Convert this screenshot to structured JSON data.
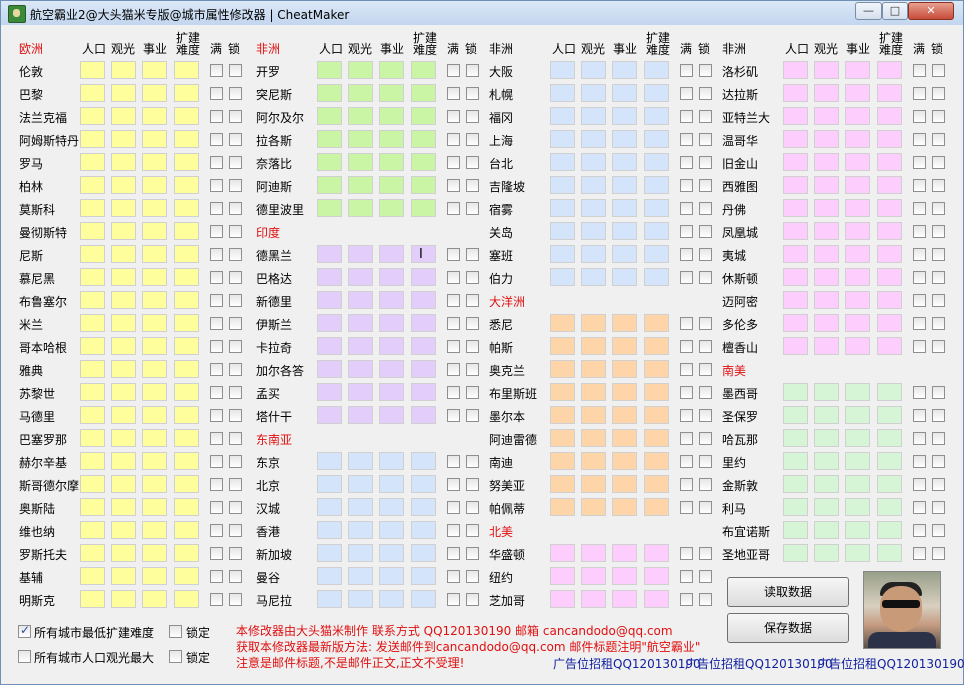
{
  "window": {
    "title": "航空霸业2@大头猫米专版@城市属性修改器 | CheatMaker",
    "min_label": "—",
    "max_label": "□",
    "close_label": "✕"
  },
  "headers": {
    "population": "人口",
    "sightseeing": "观光",
    "business": "事业",
    "expand_difficulty_top": "扩建",
    "expand_difficulty_bottom": "难度",
    "full": "满",
    "lock": "锁"
  },
  "colors": {
    "yellow": "#fefe9c",
    "green": "#c9f5a4",
    "purple": "#e3cdfa",
    "blue": "#d4e4fa",
    "orange": "#fed5a8",
    "pink": "#fdcdfd",
    "mint": "#d6f5d6",
    "region_red": "#e01010"
  },
  "columns": [
    {
      "rows": [
        {
          "label": "欧洲",
          "type": "region"
        },
        {
          "label": "伦敦",
          "color": "yellow"
        },
        {
          "label": "巴黎",
          "color": "yellow"
        },
        {
          "label": "法兰克福",
          "color": "yellow"
        },
        {
          "label": "阿姆斯特丹",
          "color": "yellow"
        },
        {
          "label": "罗马",
          "color": "yellow"
        },
        {
          "label": "柏林",
          "color": "yellow"
        },
        {
          "label": "莫斯科",
          "color": "yellow"
        },
        {
          "label": "曼彻斯特",
          "color": "yellow"
        },
        {
          "label": "尼斯",
          "color": "yellow"
        },
        {
          "label": "慕尼黑",
          "color": "yellow"
        },
        {
          "label": "布鲁塞尔",
          "color": "yellow"
        },
        {
          "label": "米兰",
          "color": "yellow"
        },
        {
          "label": "哥本哈根",
          "color": "yellow"
        },
        {
          "label": "雅典",
          "color": "yellow"
        },
        {
          "label": "苏黎世",
          "color": "yellow"
        },
        {
          "label": "马德里",
          "color": "yellow"
        },
        {
          "label": "巴塞罗那",
          "color": "yellow"
        },
        {
          "label": "赫尔辛基",
          "color": "yellow"
        },
        {
          "label": "斯哥德尔摩",
          "color": "yellow"
        },
        {
          "label": "奥斯陆",
          "color": "yellow"
        },
        {
          "label": "维也纳",
          "color": "yellow"
        },
        {
          "label": "罗斯托夫",
          "color": "yellow"
        },
        {
          "label": "基辅",
          "color": "yellow"
        },
        {
          "label": "明斯克",
          "color": "yellow"
        }
      ]
    },
    {
      "rows": [
        {
          "label": "非洲",
          "type": "region"
        },
        {
          "label": "开罗",
          "color": "green"
        },
        {
          "label": "突尼斯",
          "color": "green"
        },
        {
          "label": "阿尔及尔",
          "color": "green"
        },
        {
          "label": "拉各斯",
          "color": "green"
        },
        {
          "label": "奈落比",
          "color": "green"
        },
        {
          "label": "阿迪斯",
          "color": "green"
        },
        {
          "label": "德里波里",
          "color": "green"
        },
        {
          "label": "印度",
          "type": "region"
        },
        {
          "label": "德黑兰",
          "color": "purple"
        },
        {
          "label": "巴格达",
          "color": "purple"
        },
        {
          "label": "新德里",
          "color": "purple"
        },
        {
          "label": "伊斯兰",
          "color": "purple"
        },
        {
          "label": "卡拉奇",
          "color": "purple"
        },
        {
          "label": "加尔各答",
          "color": "purple"
        },
        {
          "label": "孟买",
          "color": "purple"
        },
        {
          "label": "塔什干",
          "color": "purple"
        },
        {
          "label": "东南亚",
          "type": "region"
        },
        {
          "label": "东京",
          "color": "blue"
        },
        {
          "label": "北京",
          "color": "blue"
        },
        {
          "label": "汉城",
          "color": "blue"
        },
        {
          "label": "香港",
          "color": "blue"
        },
        {
          "label": "新加坡",
          "color": "blue"
        },
        {
          "label": "曼谷",
          "color": "blue"
        },
        {
          "label": "马尼拉",
          "color": "blue"
        }
      ]
    },
    {
      "rows": [
        {
          "label": "非洲",
          "type": "region-black"
        },
        {
          "label": "大阪",
          "color": "blue"
        },
        {
          "label": "札幌",
          "color": "blue"
        },
        {
          "label": "福冈",
          "color": "blue"
        },
        {
          "label": "上海",
          "color": "blue"
        },
        {
          "label": "台北",
          "color": "blue"
        },
        {
          "label": "吉隆坡",
          "color": "blue"
        },
        {
          "label": "宿雾",
          "color": "blue"
        },
        {
          "label": "关岛",
          "color": "blue"
        },
        {
          "label": "塞班",
          "color": "blue"
        },
        {
          "label": "伯力",
          "color": "blue"
        },
        {
          "label": "大洋洲",
          "type": "region"
        },
        {
          "label": "悉尼",
          "color": "orange"
        },
        {
          "label": "帕斯",
          "color": "orange"
        },
        {
          "label": "奥克兰",
          "color": "orange"
        },
        {
          "label": "布里斯班",
          "color": "orange"
        },
        {
          "label": "墨尔本",
          "color": "orange"
        },
        {
          "label": "阿迪雷德",
          "color": "orange"
        },
        {
          "label": "南迪",
          "color": "orange"
        },
        {
          "label": "努美亚",
          "color": "orange"
        },
        {
          "label": "帕佩蒂",
          "color": "orange"
        },
        {
          "label": "北美",
          "type": "region"
        },
        {
          "label": "华盛顿",
          "color": "pink"
        },
        {
          "label": "纽约",
          "color": "pink"
        },
        {
          "label": "芝加哥",
          "color": "pink"
        }
      ]
    },
    {
      "rows": [
        {
          "label": "非洲",
          "type": "region-black"
        },
        {
          "label": "洛杉矶",
          "color": "pink"
        },
        {
          "label": "达拉斯",
          "color": "pink"
        },
        {
          "label": "亚特兰大",
          "color": "pink"
        },
        {
          "label": "温哥华",
          "color": "pink"
        },
        {
          "label": "旧金山",
          "color": "pink"
        },
        {
          "label": "西雅图",
          "color": "pink"
        },
        {
          "label": "丹佛",
          "color": "pink"
        },
        {
          "label": "凤凰城",
          "color": "pink"
        },
        {
          "label": "夷城",
          "color": "pink"
        },
        {
          "label": "休斯顿",
          "color": "pink"
        },
        {
          "label": "迈阿密",
          "color": "pink"
        },
        {
          "label": "多伦多",
          "color": "pink"
        },
        {
          "label": "檀香山",
          "color": "pink"
        },
        {
          "label": "南美",
          "type": "region"
        },
        {
          "label": "墨西哥",
          "color": "mint"
        },
        {
          "label": "圣保罗",
          "color": "mint"
        },
        {
          "label": "哈瓦那",
          "color": "mint"
        },
        {
          "label": "里约",
          "color": "mint"
        },
        {
          "label": "金斯敦",
          "color": "mint"
        },
        {
          "label": "利马",
          "color": "mint"
        },
        {
          "label": "布宜诺斯",
          "color": "mint"
        },
        {
          "label": "圣地亚哥",
          "color": "mint"
        }
      ]
    }
  ],
  "bottom": {
    "min_expand_label": "所有城市最低扩建难度",
    "min_expand_checked": true,
    "max_pop_label": "所有城市人口观光最大",
    "max_pop_checked": false,
    "lock_label_1": "锁定",
    "lock_label_2": "锁定",
    "note_line1": "本修改器由大头猫米制作  联系方式  QQ120130190 邮箱 cancandodo@qq.com",
    "note_line2": "获取本修改器最新版方法:  发送邮件到cancandodo@qq.com  邮件标题注明\"航空霸业\"",
    "note_line3": "注意是邮件标题,不是邮件正文,正文不受理!",
    "ad1": "广告位招租QQ120130190",
    "ad2": "广告位招租QQ120130190",
    "ad3": "广告位招租QQ120130190",
    "read_button": "读取数据",
    "save_button": "保存数据"
  }
}
